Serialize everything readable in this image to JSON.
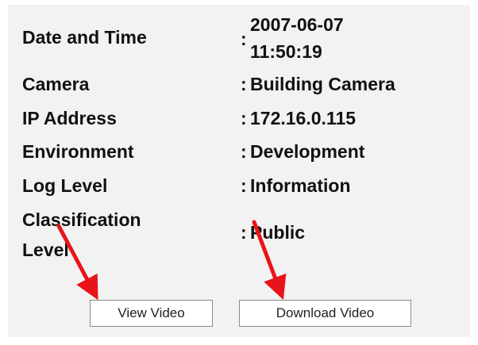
{
  "details": {
    "rows": [
      {
        "label": "Date and Time",
        "sep": ":",
        "value_line1": "2007-06-07",
        "value_line2": "11:50:19"
      },
      {
        "label": "Camera",
        "sep": ":",
        "value": "Building Camera"
      },
      {
        "label": "IP Address",
        "sep": ":",
        "value": "172.16.0.115"
      },
      {
        "label": "Environment",
        "sep": ":",
        "value": "Development"
      },
      {
        "label": "Log Level",
        "sep": ":",
        "value": "Information"
      },
      {
        "label_line1": "Classification",
        "label_line2": "Level",
        "sep": ":",
        "value": "Public"
      }
    ]
  },
  "actions": {
    "view_video": "View Video",
    "download_video": "Download Video"
  },
  "colors": {
    "panel_bg": "#f2f2f2",
    "text": "#111111",
    "arrow": "#e8141a",
    "button_border": "#8a8a8a"
  }
}
